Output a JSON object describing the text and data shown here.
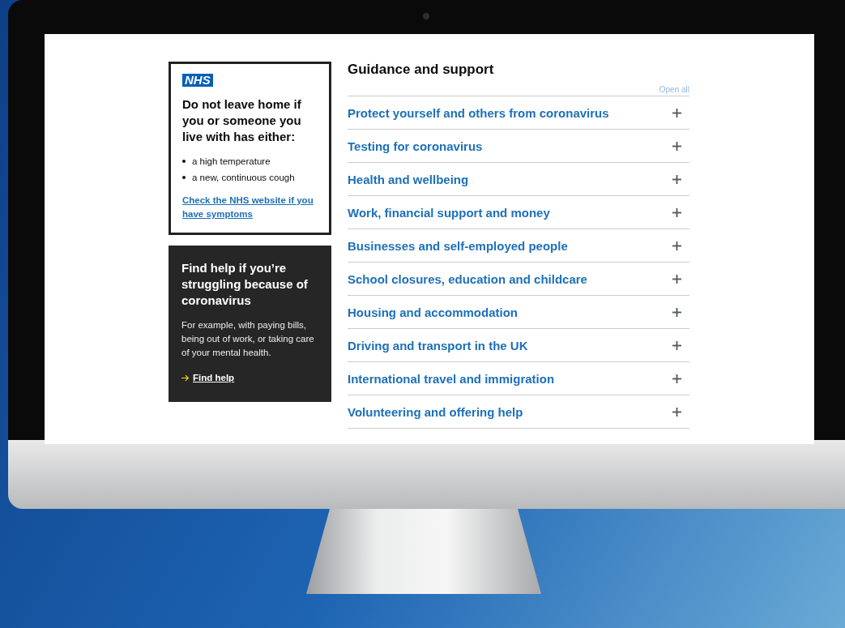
{
  "alert_card": {
    "logo": "NHS",
    "heading": "Do not leave home if you or someone you live with has either:",
    "symptoms": [
      "a high temperature",
      "a new, continuous cough"
    ],
    "link": "Check the NHS website if you have symptoms"
  },
  "help_card": {
    "heading": "Find help if you’re struggling because of coronavirus",
    "body": "For example, with paying bills, being out of work, or taking care of your mental health.",
    "link": "Find help"
  },
  "guidance": {
    "title": "Guidance and support",
    "open_all": "Open all",
    "sections": [
      {
        "label": "Protect yourself and others from coronavirus",
        "expanded": false
      },
      {
        "label": "Testing for coronavirus",
        "expanded": false
      },
      {
        "label": "Health and wellbeing",
        "expanded": false
      },
      {
        "label": "Work, financial support and money",
        "expanded": false
      },
      {
        "label": "Businesses and self-employed people",
        "expanded": false
      },
      {
        "label": "School closures, education and childcare",
        "expanded": false
      },
      {
        "label": "Housing and accommodation",
        "expanded": false
      },
      {
        "label": "Driving and transport in the UK",
        "expanded": false
      },
      {
        "label": "International travel and immigration",
        "expanded": false
      },
      {
        "label": "Volunteering and offering help",
        "expanded": false
      }
    ]
  }
}
